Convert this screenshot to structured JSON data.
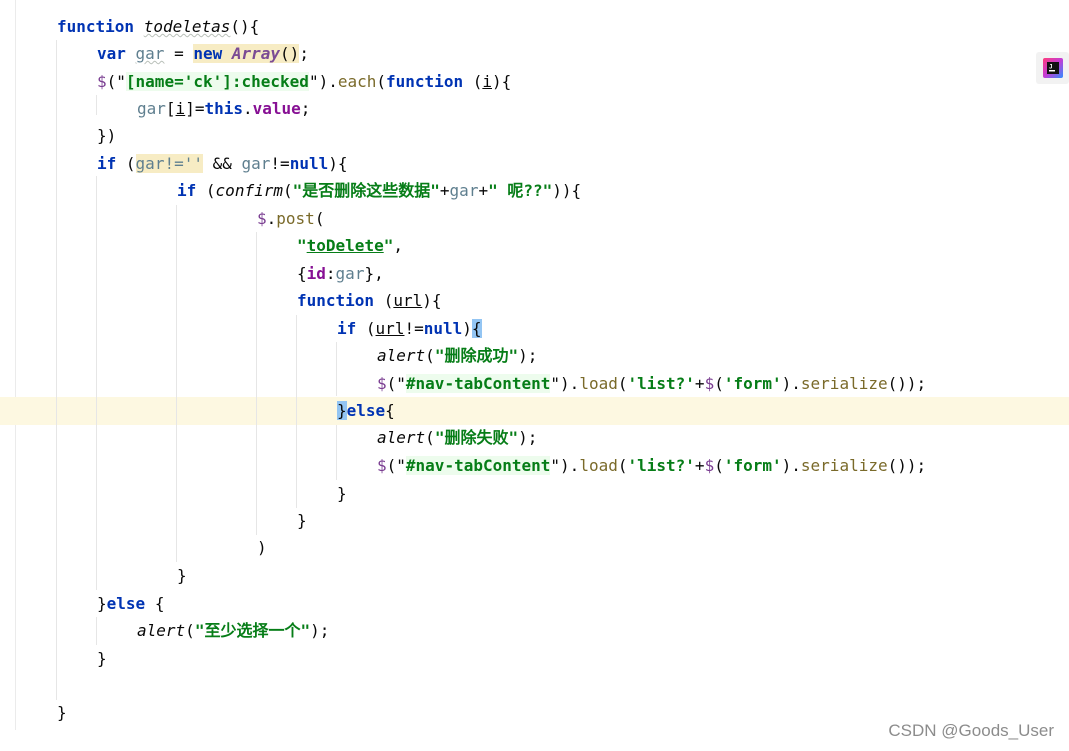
{
  "editor": {
    "lines": [
      [
        {
          "t": "function ",
          "c": "kw"
        },
        {
          "t": "todeletas",
          "c": "fn-i wavy"
        },
        {
          "t": "(){",
          "c": ""
        }
      ],
      [
        {
          "t": "var ",
          "c": "kw"
        },
        {
          "t": "gar",
          "c": "var wavy"
        },
        {
          "t": " = ",
          "c": ""
        },
        {
          "t": "new ",
          "c": "kw hl-y"
        },
        {
          "t": "Array",
          "c": "cls hl-y"
        },
        {
          "t": "()",
          "c": "hl-y"
        },
        {
          "t": ";",
          "c": ""
        }
      ],
      [
        {
          "t": "$",
          "c": "jq"
        },
        {
          "t": "(\"",
          "c": ""
        },
        {
          "t": "[name='ck']:checked",
          "c": "str hl-g"
        },
        {
          "t": "\").",
          "c": ""
        },
        {
          "t": "each",
          "c": "meth"
        },
        {
          "t": "(",
          "c": ""
        },
        {
          "t": "function ",
          "c": "kw"
        },
        {
          "t": "(",
          "c": ""
        },
        {
          "t": "i",
          "c": "und"
        },
        {
          "t": "){",
          "c": ""
        }
      ],
      [
        {
          "t": "gar",
          "c": "var"
        },
        {
          "t": "[",
          "c": ""
        },
        {
          "t": "i",
          "c": "und"
        },
        {
          "t": "]=",
          "c": ""
        },
        {
          "t": "this",
          "c": "kw"
        },
        {
          "t": ".",
          "c": ""
        },
        {
          "t": "value",
          "c": "obj"
        },
        {
          "t": ";",
          "c": ""
        }
      ],
      [
        {
          "t": "})",
          "c": ""
        }
      ],
      [
        {
          "t": "if ",
          "c": "kw"
        },
        {
          "t": "(",
          "c": ""
        },
        {
          "t": "gar!=''",
          "c": "var hl-y"
        },
        {
          "t": " && ",
          "c": ""
        },
        {
          "t": "gar",
          "c": "var"
        },
        {
          "t": "!=",
          "c": ""
        },
        {
          "t": "null",
          "c": "kw"
        },
        {
          "t": "){",
          "c": ""
        }
      ],
      [
        {
          "t": "if ",
          "c": "kw"
        },
        {
          "t": "(",
          "c": ""
        },
        {
          "t": "confirm",
          "c": "fn-i"
        },
        {
          "t": "(",
          "c": ""
        },
        {
          "t": "\"是否删除这些数据\"",
          "c": "str"
        },
        {
          "t": "+",
          "c": ""
        },
        {
          "t": "gar",
          "c": "var"
        },
        {
          "t": "+",
          "c": ""
        },
        {
          "t": "\" 呢??\"",
          "c": "str"
        },
        {
          "t": ")){",
          "c": ""
        }
      ],
      [
        {
          "t": "$",
          "c": "jq"
        },
        {
          "t": ".",
          "c": ""
        },
        {
          "t": "post",
          "c": "meth"
        },
        {
          "t": "(",
          "c": ""
        }
      ],
      [
        {
          "t": "\"",
          "c": "str"
        },
        {
          "t": "toDelete",
          "c": "str und"
        },
        {
          "t": "\"",
          "c": "str"
        },
        {
          "t": ",",
          "c": ""
        }
      ],
      [
        {
          "t": "{",
          "c": ""
        },
        {
          "t": "id",
          "c": "obj"
        },
        {
          "t": ":",
          "c": ""
        },
        {
          "t": "gar",
          "c": "var"
        },
        {
          "t": "},",
          "c": ""
        }
      ],
      [
        {
          "t": "function ",
          "c": "kw"
        },
        {
          "t": "(",
          "c": ""
        },
        {
          "t": "url",
          "c": "und"
        },
        {
          "t": "){",
          "c": ""
        }
      ],
      [
        {
          "t": "if ",
          "c": "kw"
        },
        {
          "t": "(",
          "c": ""
        },
        {
          "t": "url",
          "c": "und"
        },
        {
          "t": "!=",
          "c": ""
        },
        {
          "t": "null",
          "c": "kw"
        },
        {
          "t": ")",
          "c": ""
        },
        {
          "t": "{",
          "c": "hl-b"
        }
      ],
      [
        {
          "t": "alert",
          "c": "fn-i"
        },
        {
          "t": "(",
          "c": ""
        },
        {
          "t": "\"删除成功\"",
          "c": "str"
        },
        {
          "t": ");",
          "c": ""
        }
      ],
      [
        {
          "t": "$",
          "c": "jq"
        },
        {
          "t": "(\"",
          "c": ""
        },
        {
          "t": "#nav-tabContent",
          "c": "str hl-g"
        },
        {
          "t": "\").",
          "c": ""
        },
        {
          "t": "load",
          "c": "meth"
        },
        {
          "t": "(",
          "c": ""
        },
        {
          "t": "'list?'",
          "c": "str"
        },
        {
          "t": "+",
          "c": ""
        },
        {
          "t": "$",
          "c": "jq"
        },
        {
          "t": "(",
          "c": ""
        },
        {
          "t": "'form'",
          "c": "str"
        },
        {
          "t": ").",
          "c": ""
        },
        {
          "t": "serialize",
          "c": "meth"
        },
        {
          "t": "());",
          "c": ""
        }
      ],
      [
        {
          "t": "}",
          "c": "hl-b"
        },
        {
          "t": "else",
          "c": "kw"
        },
        {
          "t": "{",
          "c": ""
        }
      ],
      [
        {
          "t": "alert",
          "c": "fn-i"
        },
        {
          "t": "(",
          "c": ""
        },
        {
          "t": "\"删除失败\"",
          "c": "str"
        },
        {
          "t": ");",
          "c": ""
        }
      ],
      [
        {
          "t": "$",
          "c": "jq"
        },
        {
          "t": "(\"",
          "c": ""
        },
        {
          "t": "#nav-tabContent",
          "c": "str hl-g"
        },
        {
          "t": "\").",
          "c": ""
        },
        {
          "t": "load",
          "c": "meth"
        },
        {
          "t": "(",
          "c": ""
        },
        {
          "t": "'list?'",
          "c": "str"
        },
        {
          "t": "+",
          "c": ""
        },
        {
          "t": "$",
          "c": "jq"
        },
        {
          "t": "(",
          "c": ""
        },
        {
          "t": "'form'",
          "c": "str"
        },
        {
          "t": ").",
          "c": ""
        },
        {
          "t": "serialize",
          "c": "meth"
        },
        {
          "t": "());",
          "c": ""
        }
      ],
      [
        {
          "t": "}",
          "c": ""
        }
      ],
      [
        {
          "t": "}",
          "c": ""
        }
      ],
      [
        {
          "t": ")",
          "c": ""
        }
      ],
      [
        {
          "t": "}",
          "c": ""
        }
      ],
      [
        {
          "t": "}",
          "c": ""
        },
        {
          "t": "else ",
          "c": "kw"
        },
        {
          "t": "{",
          "c": ""
        }
      ],
      [
        {
          "t": "alert",
          "c": "fn-i"
        },
        {
          "t": "(",
          "c": ""
        },
        {
          "t": "\"至少选择一个\"",
          "c": "str"
        },
        {
          "t": ");",
          "c": ""
        }
      ],
      [
        {
          "t": "}",
          "c": ""
        }
      ],
      [],
      [
        {
          "t": "}",
          "c": ""
        }
      ]
    ]
  },
  "watermark": "CSDN @Goods_User",
  "plugin_icon": "jetbrains-ai-icon"
}
